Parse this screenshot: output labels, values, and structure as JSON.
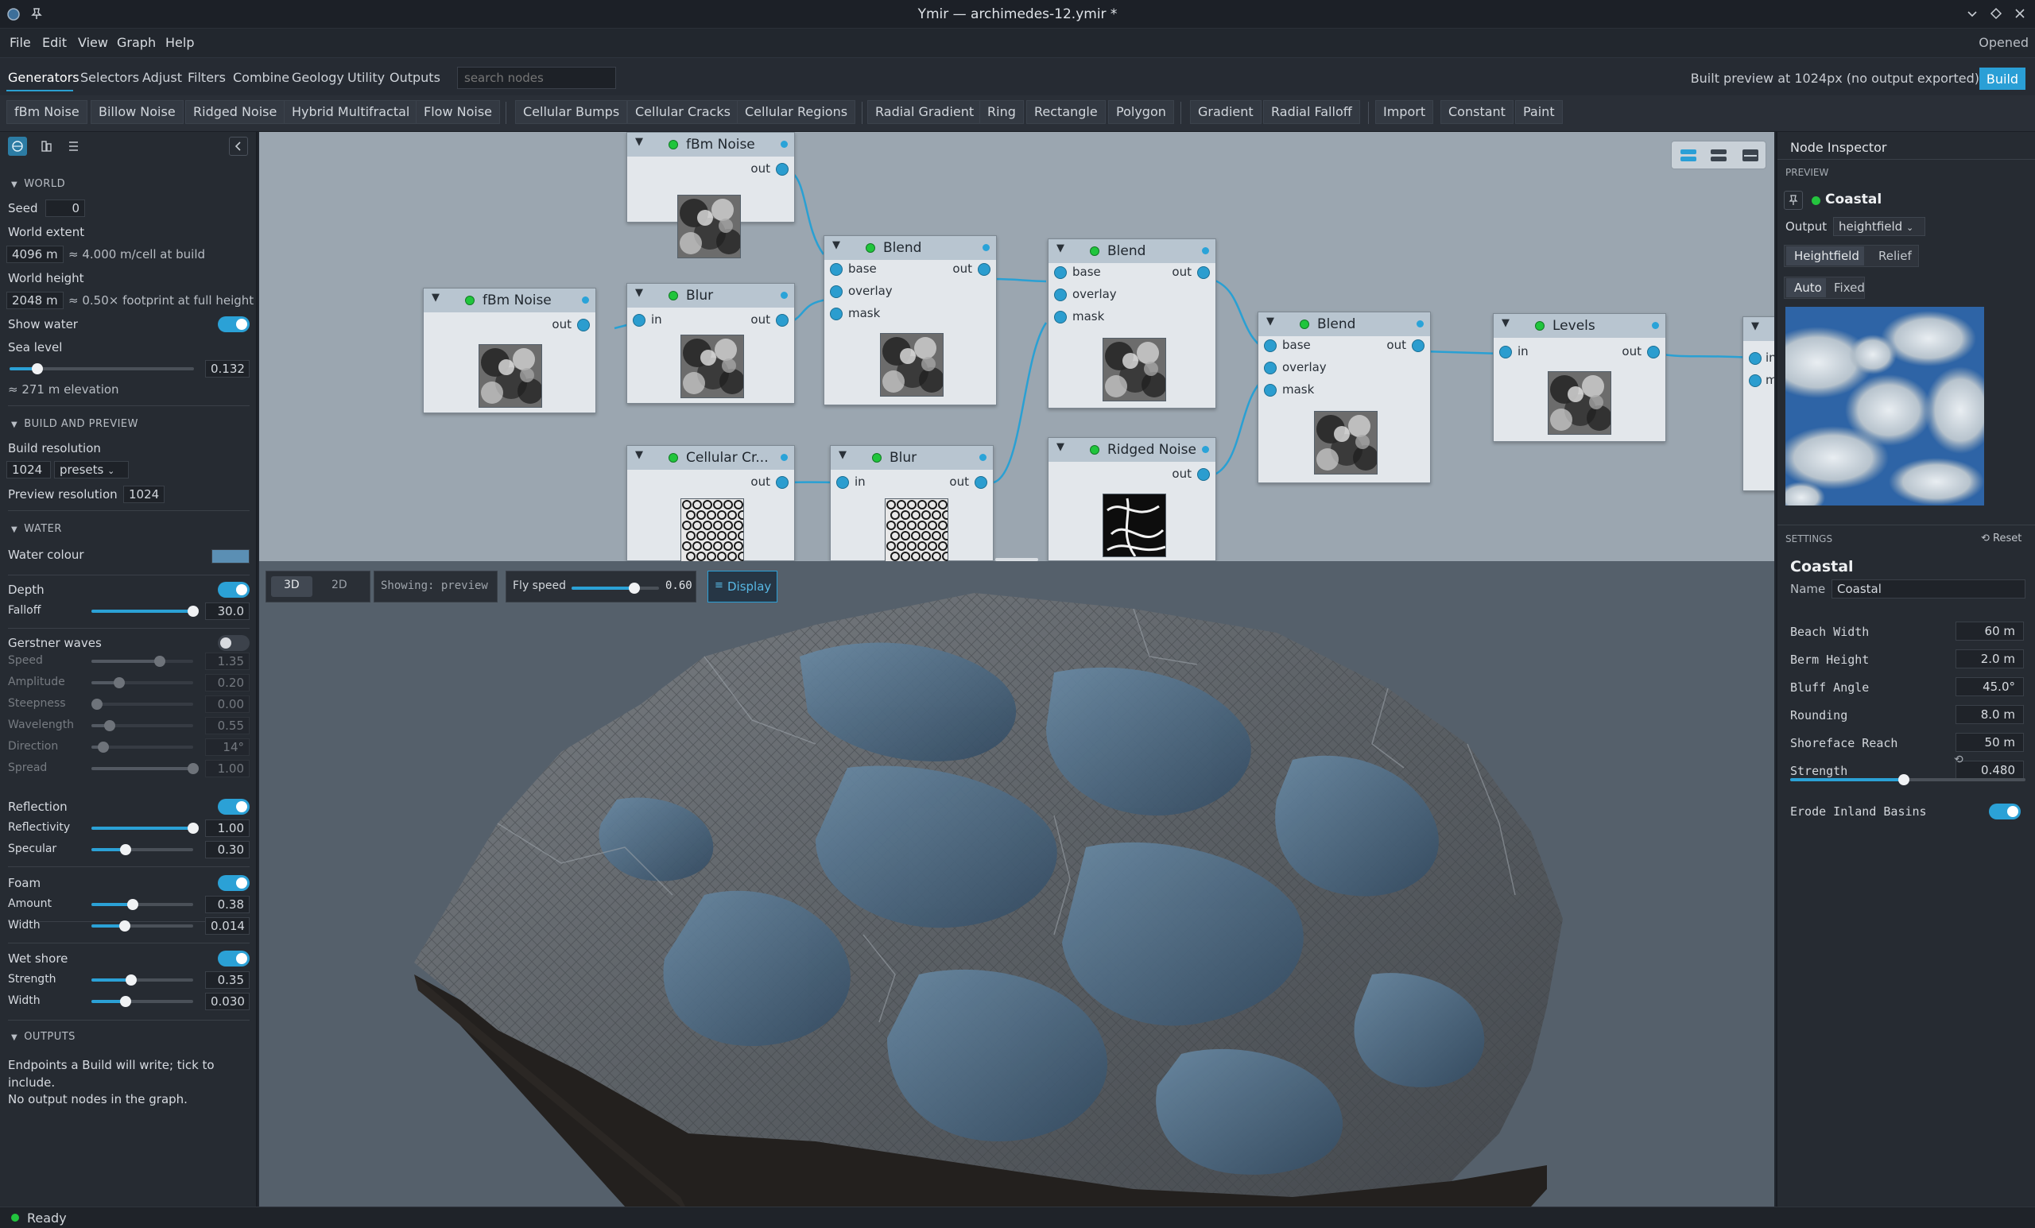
{
  "window": {
    "title": "Ymir — archimedes-12.ymir *"
  },
  "menu": [
    "File",
    "Edit",
    "View",
    "Graph",
    "Help"
  ],
  "menu_right": "Opened",
  "categories": [
    "Generators",
    "Selectors",
    "Adjust",
    "Filters",
    "Combine",
    "Geology",
    "Utility",
    "Outputs"
  ],
  "search": {
    "placeholder": "search nodes"
  },
  "build_status": "Built preview at 1024px (no output exported)",
  "build_label": "Build",
  "node_buttons": [
    "fBm Noise",
    "Billow Noise",
    "Ridged Noise",
    "Hybrid Multifractal",
    "Flow Noise",
    "Cellular Bumps",
    "Cellular Cracks",
    "Cellular Regions",
    "Radial Gradient",
    "Ring",
    "Rectangle",
    "Polygon",
    "Gradient",
    "Radial Falloff",
    "Import",
    "Constant",
    "Paint"
  ],
  "left": {
    "world": {
      "header": "WORLD",
      "seed_label": "Seed",
      "seed": "0",
      "extent_label": "World extent",
      "extent": "4096 m",
      "extent_note": "≈ 4.000 m/cell at build",
      "height_label": "World height",
      "height": "2048 m",
      "height_note": "≈ 0.50× footprint at full height",
      "show_water": "Show water",
      "sea_level_label": "Sea level",
      "sea_level": "0.132",
      "elevation_note": "≈ 271 m elevation"
    },
    "build": {
      "header": "BUILD AND PREVIEW",
      "build_res_label": "Build resolution",
      "build_res": "1024",
      "presets": "presets",
      "preview_res_label": "Preview resolution",
      "preview_res": "1024"
    },
    "water": {
      "header": "WATER",
      "colour_label": "Water colour",
      "colour": "#5b8fb4",
      "depth_label": "Depth",
      "falloff_label": "Falloff",
      "falloff": "30.0",
      "gerstner_label": "Gerstner waves",
      "waves": [
        {
          "label": "Speed",
          "value": "1.35",
          "frac": 0.65
        },
        {
          "label": "Amplitude",
          "value": "0.20",
          "frac": 0.23
        },
        {
          "label": "Steepness",
          "value": "0.00",
          "frac": 0.0
        },
        {
          "label": "Wavelength",
          "value": "0.55",
          "frac": 0.13
        },
        {
          "label": "Direction",
          "value": "14°",
          "frac": 0.07
        },
        {
          "label": "Spread",
          "value": "1.00",
          "frac": 1.0
        }
      ],
      "reflection_label": "Reflection",
      "reflectivity_label": "Reflectivity",
      "reflectivity": "1.00",
      "specular_label": "Specular",
      "specular": "0.30",
      "foam_label": "Foam",
      "amount_label": "Amount",
      "amount": "0.38",
      "foam_width_label": "Width",
      "foam_width": "0.014",
      "wetshore_label": "Wet shore",
      "strength_label": "Strength",
      "strength": "0.35",
      "wet_width_label": "Width",
      "wet_width": "0.030"
    },
    "outputs": {
      "header": "OUTPUTS",
      "note1": "Endpoints a Build will write; tick to include.",
      "note2": "No output nodes in the graph."
    }
  },
  "graph": {
    "nodes": [
      {
        "id": "fbm1",
        "title": "fBm Noise"
      },
      {
        "id": "fbm2",
        "title": "fBm Noise"
      },
      {
        "id": "blur1",
        "title": "Blur"
      },
      {
        "id": "cell",
        "title": "Cellular Cr..."
      },
      {
        "id": "blur2",
        "title": "Blur"
      },
      {
        "id": "blend1",
        "title": "Blend"
      },
      {
        "id": "blend2",
        "title": "Blend"
      },
      {
        "id": "ridged",
        "title": "Ridged Noise"
      },
      {
        "id": "blend3",
        "title": "Blend"
      },
      {
        "id": "levels",
        "title": "Levels"
      }
    ],
    "port_labels": {
      "out": "out",
      "in": "in",
      "base": "base",
      "overlay": "overlay",
      "mask": "mask",
      "m": "m"
    }
  },
  "viewport": {
    "mode_3d": "3D",
    "mode_2d": "2D",
    "showing": "Showing: preview",
    "fly_label": "Fly speed",
    "fly_value": "0.60",
    "display_label": "Display"
  },
  "inspector": {
    "title": "Node Inspector",
    "preview_header": "PREVIEW",
    "node_name": "Coastal",
    "output_label": "Output",
    "output_value": "heightfield",
    "view_tabs": [
      "Heightfield",
      "Relief"
    ],
    "scale_tabs": [
      "Auto",
      "Fixed"
    ],
    "settings_header": "SETTINGS",
    "reset_label": "Reset",
    "settings_title": "Coastal",
    "name_label": "Name",
    "name_value": "Coastal",
    "params": [
      {
        "label": "Beach Width",
        "value": "60 m"
      },
      {
        "label": "Berm Height",
        "value": "2.0 m"
      },
      {
        "label": "Bluff Angle",
        "value": "45.0°"
      },
      {
        "label": "Rounding",
        "value": "8.0 m"
      },
      {
        "label": "Shoreface Reach",
        "value": "50 m"
      },
      {
        "label": "Strength",
        "value": "0.480"
      }
    ],
    "erode_label": "Erode Inland Basins"
  },
  "status": "Ready",
  "accent": "#2ba1d6"
}
